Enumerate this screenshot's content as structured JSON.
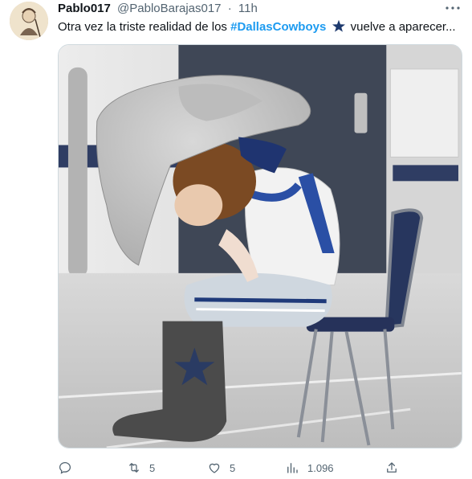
{
  "tweet": {
    "author_name": "Pablo017",
    "handle": "@PabloBarajas017",
    "separator": "·",
    "time": "11h",
    "more_icon": "more-horizontal-icon",
    "text_before": "Otra vez la triste realidad de los",
    "hashtag": "#DallasCowboys",
    "emoji": "star-emoji-icon",
    "text_after": "vuelve a aparecer...",
    "media": {
      "description_icon": "mascot-photo"
    }
  },
  "actions": {
    "reply": {
      "icon": "reply-icon",
      "count": ""
    },
    "retweet": {
      "icon": "retweet-icon",
      "count": "5"
    },
    "like": {
      "icon": "heart-icon",
      "count": "5"
    },
    "views": {
      "icon": "analytics-icon",
      "count": "1.096"
    },
    "share": {
      "icon": "share-icon",
      "count": ""
    }
  },
  "colors": {
    "accent": "#1d9bf0",
    "secondary_text": "#536471",
    "primary_text": "#0f1419",
    "star": "#1e3a6e"
  }
}
